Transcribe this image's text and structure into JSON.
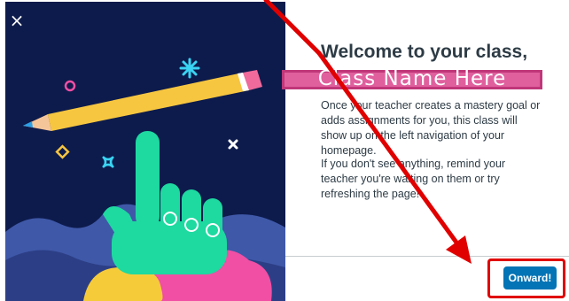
{
  "dialog": {
    "close_label": "×",
    "title": "Welcome to your class,",
    "class_name": "Class Name Here",
    "paragraph1": "Once your teacher creates a mastery goal or adds assignments for you, this class will show up on the left navigation of your homepage.",
    "paragraph2": "If you don't see anything, remind your teacher you're waiting on them or try refreshing the page!",
    "onward_label": "Onward!"
  },
  "colors": {
    "illustration_bg": "#0d1b4c",
    "primary_button": "#0374b5",
    "highlight_banner": "#e0609e",
    "annotation_red": "#e00000"
  },
  "icons": {
    "close": "close-icon",
    "pencil": "pencil-icon",
    "hand": "pointing-hand-icon"
  }
}
